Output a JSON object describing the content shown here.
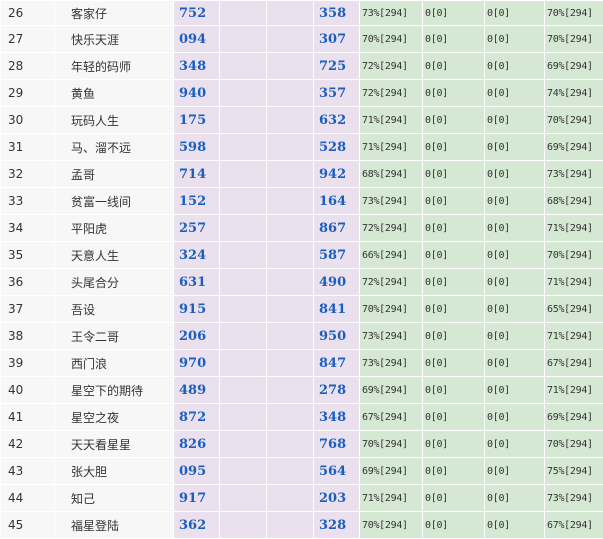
{
  "rows": [
    {
      "rank": "26",
      "name": "客家仔",
      "n1": "752",
      "n2": "358",
      "s1": "73%[294]",
      "s2": "0[0]",
      "s3": "0[0]",
      "s4": "70%[294]"
    },
    {
      "rank": "27",
      "name": "快乐天涯",
      "n1": "094",
      "n2": "307",
      "s1": "70%[294]",
      "s2": "0[0]",
      "s3": "0[0]",
      "s4": "70%[294]"
    },
    {
      "rank": "28",
      "name": "年轻的码师",
      "n1": "348",
      "n2": "725",
      "s1": "72%[294]",
      "s2": "0[0]",
      "s3": "0[0]",
      "s4": "69%[294]"
    },
    {
      "rank": "29",
      "name": "黄鱼",
      "n1": "940",
      "n2": "357",
      "s1": "72%[294]",
      "s2": "0[0]",
      "s3": "0[0]",
      "s4": "74%[294]"
    },
    {
      "rank": "30",
      "name": "玩码人生",
      "n1": "175",
      "n2": "632",
      "s1": "71%[294]",
      "s2": "0[0]",
      "s3": "0[0]",
      "s4": "70%[294]"
    },
    {
      "rank": "31",
      "name": "马、溜不远",
      "n1": "598",
      "n2": "528",
      "s1": "71%[294]",
      "s2": "0[0]",
      "s3": "0[0]",
      "s4": "69%[294]"
    },
    {
      "rank": "32",
      "name": "孟哥",
      "n1": "714",
      "n2": "942",
      "s1": "68%[294]",
      "s2": "0[0]",
      "s3": "0[0]",
      "s4": "73%[294]"
    },
    {
      "rank": "33",
      "name": "贫富一线间",
      "n1": "152",
      "n2": "164",
      "s1": "73%[294]",
      "s2": "0[0]",
      "s3": "0[0]",
      "s4": "68%[294]"
    },
    {
      "rank": "34",
      "name": "平阳虎",
      "n1": "257",
      "n2": "867",
      "s1": "72%[294]",
      "s2": "0[0]",
      "s3": "0[0]",
      "s4": "71%[294]"
    },
    {
      "rank": "35",
      "name": "天意人生",
      "n1": "324",
      "n2": "587",
      "s1": "66%[294]",
      "s2": "0[0]",
      "s3": "0[0]",
      "s4": "70%[294]"
    },
    {
      "rank": "36",
      "name": "头尾合分",
      "n1": "631",
      "n2": "490",
      "s1": "72%[294]",
      "s2": "0[0]",
      "s3": "0[0]",
      "s4": "71%[294]"
    },
    {
      "rank": "37",
      "name": "吾设",
      "n1": "915",
      "n2": "841",
      "s1": "70%[294]",
      "s2": "0[0]",
      "s3": "0[0]",
      "s4": "65%[294]"
    },
    {
      "rank": "38",
      "name": "王令二哥",
      "n1": "206",
      "n2": "950",
      "s1": "73%[294]",
      "s2": "0[0]",
      "s3": "0[0]",
      "s4": "71%[294]"
    },
    {
      "rank": "39",
      "name": "西门浪",
      "n1": "970",
      "n2": "847",
      "s1": "73%[294]",
      "s2": "0[0]",
      "s3": "0[0]",
      "s4": "67%[294]"
    },
    {
      "rank": "40",
      "name": "星空下的期待",
      "n1": "489",
      "n2": "278",
      "s1": "69%[294]",
      "s2": "0[0]",
      "s3": "0[0]",
      "s4": "71%[294]"
    },
    {
      "rank": "41",
      "name": "星空之夜",
      "n1": "872",
      "n2": "348",
      "s1": "67%[294]",
      "s2": "0[0]",
      "s3": "0[0]",
      "s4": "69%[294]"
    },
    {
      "rank": "42",
      "name": "天天看星星",
      "n1": "826",
      "n2": "768",
      "s1": "70%[294]",
      "s2": "0[0]",
      "s3": "0[0]",
      "s4": "70%[294]"
    },
    {
      "rank": "43",
      "name": "张大胆",
      "n1": "095",
      "n2": "564",
      "s1": "69%[294]",
      "s2": "0[0]",
      "s3": "0[0]",
      "s4": "75%[294]"
    },
    {
      "rank": "44",
      "name": "知己",
      "n1": "917",
      "n2": "203",
      "s1": "71%[294]",
      "s2": "0[0]",
      "s3": "0[0]",
      "s4": "73%[294]"
    },
    {
      "rank": "45",
      "name": "福星登陆",
      "n1": "362",
      "n2": "328",
      "s1": "70%[294]",
      "s2": "0[0]",
      "s3": "0[0]",
      "s4": "67%[294]"
    }
  ]
}
